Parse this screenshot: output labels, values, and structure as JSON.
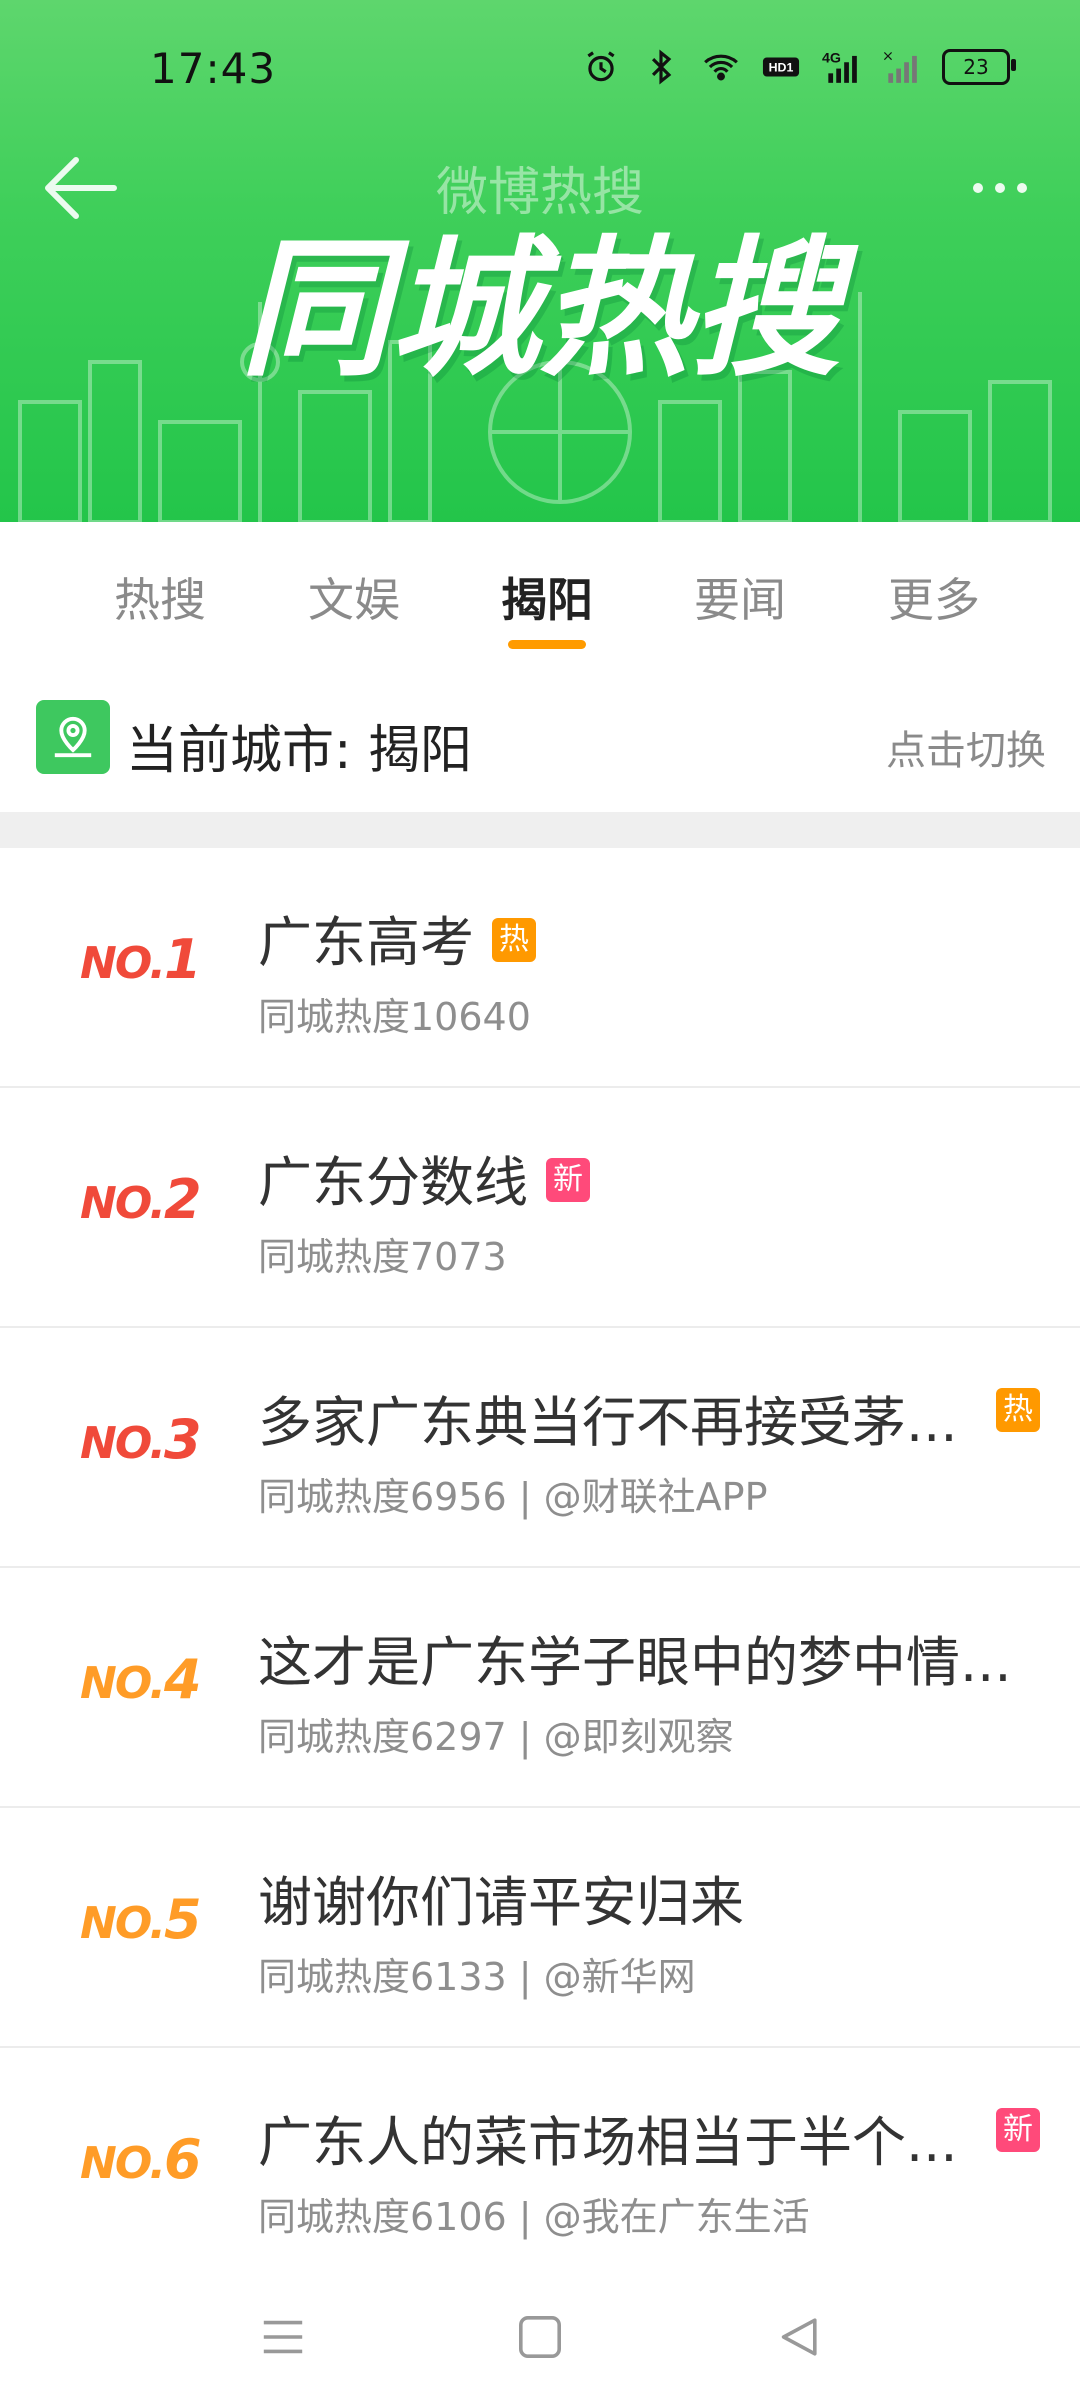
{
  "status_bar": {
    "time": "17:43",
    "network": "4G",
    "battery": "23"
  },
  "header": {
    "subtitle": "微博热搜",
    "title": "同城热搜"
  },
  "tabs": [
    {
      "label": "热搜"
    },
    {
      "label": "文娱"
    },
    {
      "label": "揭阳"
    },
    {
      "label": "要闻"
    },
    {
      "label": "更多"
    }
  ],
  "active_tab": "揭阳",
  "city": {
    "label": "当前城市: 揭阳",
    "switch": "点击切换"
  },
  "items": [
    {
      "rank_prefix": "NO.",
      "rank": "1",
      "title": "广东高考",
      "badge": "热",
      "badge_type": "hot",
      "sub": "同城热度10640",
      "rank_color": "#f04a3a"
    },
    {
      "rank_prefix": "NO.",
      "rank": "2",
      "title": "广东分数线",
      "badge": "新",
      "badge_type": "new",
      "sub": "同城热度7073",
      "rank_color": "#f04a3a"
    },
    {
      "rank_prefix": "NO.",
      "rank": "3",
      "title": "多家广东典当行不再接受茅...",
      "badge": "热",
      "badge_type": "hot",
      "sub": "同城热度6956 | @财联社APP",
      "rank_color": "#f04a3a"
    },
    {
      "rank_prefix": "NO.",
      "rank": "4",
      "title": "这才是广东学子眼中的梦中情...",
      "badge": "",
      "badge_type": "",
      "sub": "同城热度6297 | @即刻观察",
      "rank_color": "#ff9c27"
    },
    {
      "rank_prefix": "NO.",
      "rank": "5",
      "title": "谢谢你们请平安归来",
      "badge": "",
      "badge_type": "",
      "sub": "同城热度6133 | @新华网",
      "rank_color": "#ff9c27"
    },
    {
      "rank_prefix": "NO.",
      "rank": "6",
      "title": "广东人的菜市场相当于半个...",
      "badge": "新",
      "badge_type": "new",
      "sub": "同城热度6106 | @我在广东生活",
      "rank_color": "#ff9c27"
    }
  ],
  "icons": {
    "back": "arrow-left-icon",
    "more": "more-dots-icon",
    "location": "map-pin-icon",
    "nav_menu": "menu-lines-icon",
    "nav_home": "square-icon",
    "nav_back": "triangle-back-icon"
  },
  "colors": {
    "brand_green": "#3fcf5a",
    "accent_orange": "#ff9b00",
    "hot_badge": "#ff9900",
    "new_badge": "#ff4a7a"
  }
}
